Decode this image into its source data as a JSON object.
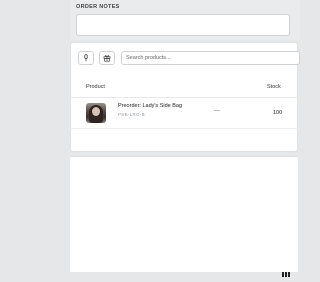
{
  "order_notes": {
    "label": "ORDER NOTES",
    "value": ""
  },
  "product_picker": {
    "search_placeholder": "Search products...",
    "buttons": [
      "microphone-icon",
      "gift-icon"
    ]
  },
  "table": {
    "columns": {
      "product": "Product",
      "stock": "Stock"
    },
    "rows": [
      {
        "name": "Preorder: Lady's Side Bag",
        "sku": "PSB-LRG-B",
        "placeholder": "---",
        "stock": "100"
      }
    ]
  }
}
